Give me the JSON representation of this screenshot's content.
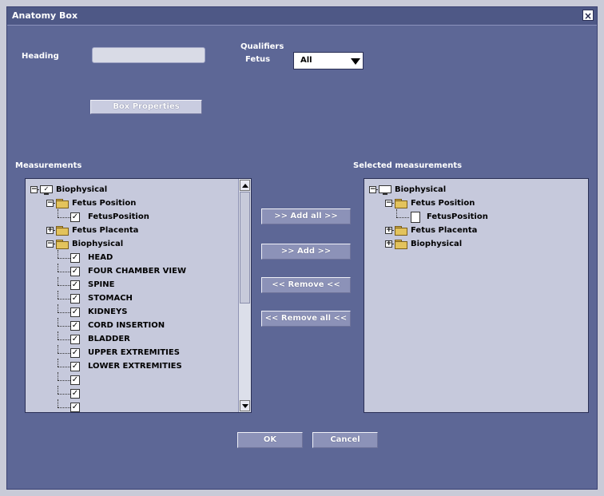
{
  "window": {
    "title": "Anatomy Box"
  },
  "heading": {
    "label": "Heading",
    "value": ""
  },
  "qualifiers": {
    "label": "Qualifiers",
    "fetus_label": "Fetus",
    "fetus_value": "All"
  },
  "box_properties_label": "Box Properties",
  "measurements": {
    "label": "Measurements",
    "items": [
      {
        "label": "Biophysical",
        "level": 0,
        "icon": "monitor-icon",
        "checked": true,
        "expander": "−"
      },
      {
        "label": "Fetus Position",
        "level": 1,
        "icon": "folder-icon",
        "expander": "−"
      },
      {
        "label": "FetusPosition",
        "level": 2,
        "icon": "checkbox",
        "checked": true
      },
      {
        "label": "Fetus Placenta",
        "level": 1,
        "icon": "folder-icon",
        "expander": "+"
      },
      {
        "label": "Biophysical",
        "level": 1,
        "icon": "folder-icon",
        "expander": "−"
      },
      {
        "label": "HEAD",
        "level": 2,
        "icon": "checkbox",
        "checked": true
      },
      {
        "label": "FOUR CHAMBER VIEW",
        "level": 2,
        "icon": "checkbox",
        "checked": true
      },
      {
        "label": "SPINE",
        "level": 2,
        "icon": "checkbox",
        "checked": true
      },
      {
        "label": "STOMACH",
        "level": 2,
        "icon": "checkbox",
        "checked": true
      },
      {
        "label": "KIDNEYS",
        "level": 2,
        "icon": "checkbox",
        "checked": true
      },
      {
        "label": "CORD INSERTION",
        "level": 2,
        "icon": "checkbox",
        "checked": true
      },
      {
        "label": "BLADDER",
        "level": 2,
        "icon": "checkbox",
        "checked": true
      },
      {
        "label": "UPPER EXTREMITIES",
        "level": 2,
        "icon": "checkbox",
        "checked": true
      },
      {
        "label": "LOWER EXTREMITIES",
        "level": 2,
        "icon": "checkbox",
        "checked": true
      },
      {
        "label": "",
        "level": 2,
        "icon": "checkbox",
        "checked": true
      },
      {
        "label": "",
        "level": 2,
        "icon": "checkbox",
        "checked": true
      },
      {
        "label": "",
        "level": 2,
        "icon": "checkbox",
        "checked": true
      }
    ]
  },
  "buttons": {
    "add_all": ">> Add all >>",
    "add": ">> Add >>",
    "remove": "<< Remove <<",
    "remove_all": "<< Remove all <<",
    "ok": "OK",
    "cancel": "Cancel"
  },
  "selected": {
    "label": "Selected measurements",
    "items": [
      {
        "label": "Biophysical",
        "level": 0,
        "icon": "monitor-icon",
        "expander": "−"
      },
      {
        "label": "Fetus Position",
        "level": 1,
        "icon": "folder-icon",
        "expander": "−"
      },
      {
        "label": "FetusPosition",
        "level": 2,
        "icon": "document-icon"
      },
      {
        "label": "Fetus Placenta",
        "level": 1,
        "icon": "folder-icon",
        "expander": "+"
      },
      {
        "label": "Biophysical",
        "level": 1,
        "icon": "folder-icon",
        "expander": "+"
      }
    ]
  },
  "colors": {
    "window_bg": "#5d6796",
    "list_bg": "#c6c9dc",
    "folder": "#e3c35c"
  }
}
